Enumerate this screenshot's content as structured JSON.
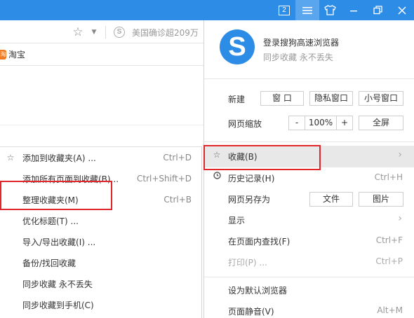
{
  "titlebar": {
    "tab_count": "2",
    "menu_icon": "menu-icon",
    "skin_icon": "shirt-icon",
    "restore_icon": "restore-icon",
    "close_icon": "close-icon",
    "color": "#2d8ce6"
  },
  "addressbar": {
    "news_text": "美国确诊超209万"
  },
  "bookmarks": {
    "items": [
      {
        "label": "淘宝"
      }
    ]
  },
  "favorites_submenu": {
    "items": [
      {
        "label": "添加到收藏夹(A) ...",
        "shortcut": "Ctrl+D",
        "icon": "star-icon"
      },
      {
        "label": "添加所有页面到收藏(B)...",
        "shortcut": "Ctrl+Shift+D"
      },
      {
        "label": "整理收藏夹(M)",
        "shortcut": "Ctrl+B"
      },
      {
        "label": "优化标题(T) ...",
        "shortcut": ""
      },
      {
        "label": "导入/导出收藏(I) ...",
        "shortcut": ""
      },
      {
        "label": "备份/找回收藏",
        "shortcut": ""
      },
      {
        "label": "同步收藏 永不丢失",
        "shortcut": ""
      },
      {
        "label": "同步收藏到手机(C)",
        "shortcut": ""
      }
    ]
  },
  "main_menu": {
    "login_text": "登录搜狗高速浏览器",
    "sync_text": "同步收藏 永不丢失",
    "new_row": {
      "label": "新建",
      "buttons": [
        "窗 口",
        "隐私窗口",
        "小号窗口"
      ]
    },
    "zoom_row": {
      "label": "网页缩放",
      "minus": "-",
      "value": "100%",
      "plus": "+",
      "fullscreen": "全屏"
    },
    "items": [
      {
        "label": "收藏(B)",
        "icon": "star-icon",
        "shortcut": "",
        "arrow": "›"
      },
      {
        "label": "历史记录(H)",
        "icon": "history-icon",
        "shortcut": "Ctrl+H"
      },
      {
        "label": "网页另存为",
        "buttons": [
          "文件",
          "图片"
        ]
      },
      {
        "label": "显示",
        "arrow": "›"
      },
      {
        "label": "在页面内查找(F)",
        "shortcut": "Ctrl+F"
      },
      {
        "label": "打印(P) ...",
        "shortcut": "Ctrl+P"
      },
      {
        "label": "设为默认浏览器",
        "shortcut": ""
      },
      {
        "label": "页面静音(V)",
        "shortcut": "Alt+M"
      }
    ]
  },
  "highlight_color": "#e0262b"
}
